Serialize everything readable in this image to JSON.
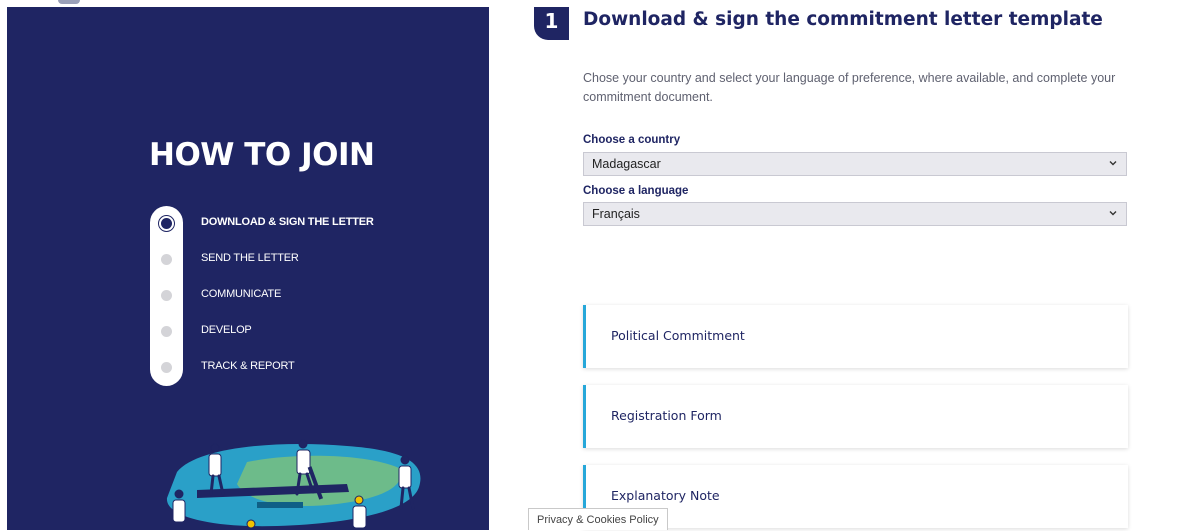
{
  "sidebar": {
    "title": "HOW TO JOIN",
    "steps": [
      {
        "label": "DOWNLOAD & SIGN THE LETTER",
        "active": true
      },
      {
        "label": "SEND THE LETTER",
        "active": false
      },
      {
        "label": "COMMUNICATE",
        "active": false
      },
      {
        "label": "DEVELOP",
        "active": false
      },
      {
        "label": "TRACK & REPORT",
        "active": false
      }
    ]
  },
  "main": {
    "step_number": "1",
    "heading": "Download & sign the commitment letter template",
    "intro": "Chose your country and select your language of preference, where available, and complete your commitment document.",
    "country": {
      "label": "Choose a country",
      "value": "Madagascar"
    },
    "language": {
      "label": "Choose a language",
      "value": "Français"
    },
    "documents": [
      {
        "label": "Political Commitment"
      },
      {
        "label": "Registration Form"
      },
      {
        "label": "Explanatory Note"
      }
    ]
  },
  "footer": {
    "privacy_label": "Privacy & Cookies Policy"
  },
  "colors": {
    "navy": "#1f2563",
    "accent": "#26a7d9",
    "teal": "#2aa0c8",
    "green": "#6dbb8a"
  }
}
